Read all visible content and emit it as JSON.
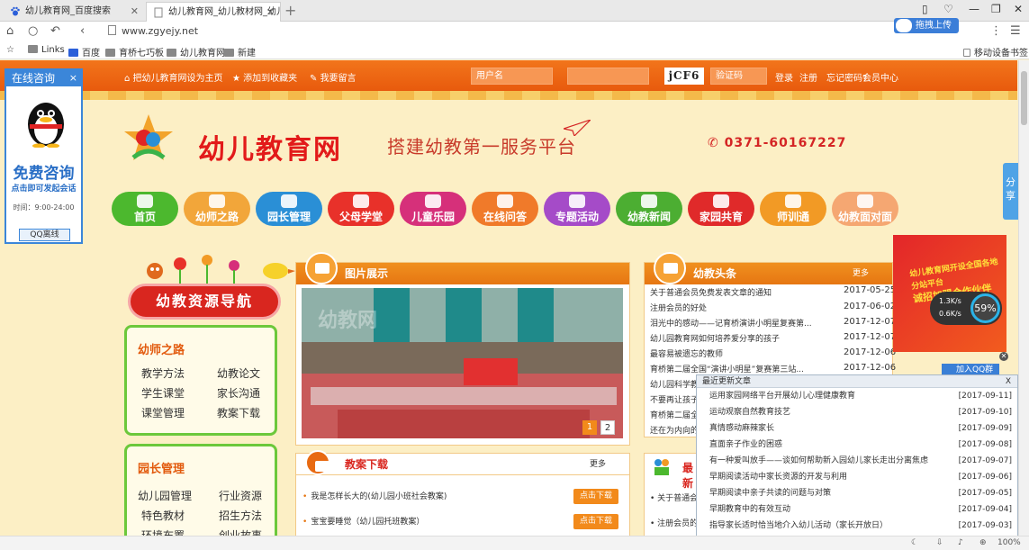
{
  "browser": {
    "tabs": [
      {
        "label": "幼儿教育网_百度搜索"
      },
      {
        "label": "幼儿教育网_幼儿教材网_幼儿"
      }
    ],
    "url": "www.zgyejy.net",
    "upload_label": "拖拽上传",
    "bookmarks": [
      "Links",
      "百度",
      "育桥七巧板",
      "幼儿教育网",
      "新建"
    ],
    "mobile_bookmarks": "移动设备书签",
    "zoom": "100%"
  },
  "topbar": {
    "set_home": "把幼儿教育网设为主页",
    "favorite": "添加到收藏夹",
    "message": "我要留言",
    "username_placeholder": "用户名",
    "captcha_text": "jCF6",
    "captcha_placeholder": "验证码",
    "login": "登录",
    "register": "注册",
    "forgot": "忘记密码?",
    "member": "会员中心"
  },
  "header": {
    "site_name": "幼儿教育网",
    "slogan": "搭建幼教第一服务平台",
    "phone": "0371-60167227"
  },
  "nav": [
    {
      "label": "首页",
      "color": "#4cb82e"
    },
    {
      "label": "幼师之路",
      "color": "#f2a63a"
    },
    {
      "label": "园长管理",
      "color": "#2a8fd6"
    },
    {
      "label": "父母学堂",
      "color": "#e8312a"
    },
    {
      "label": "儿童乐园",
      "color": "#d6307a"
    },
    {
      "label": "在线问答",
      "color": "#f07a2a"
    },
    {
      "label": "专题活动",
      "color": "#a54bc8"
    },
    {
      "label": "幼教新闻",
      "color": "#4cae32"
    },
    {
      "label": "家园共育",
      "color": "#e02a2a"
    },
    {
      "label": "师训通",
      "color": "#f29a25"
    },
    {
      "label": "幼教面对面",
      "color": "#f5a772"
    }
  ],
  "sidebar": {
    "title": "幼教资源导航",
    "cats": [
      {
        "title": "幼师之路",
        "items": [
          "教学方法",
          "幼教论文",
          "学生课堂",
          "家长沟通",
          "课堂管理",
          "教案下载"
        ]
      },
      {
        "title": "园长管理",
        "items": [
          "幼儿园管理",
          "行业资源",
          "特色教材",
          "招生方法",
          "环境布置",
          "创业故事"
        ]
      }
    ]
  },
  "photos": {
    "title": "图片展示",
    "watermark": "幼教网",
    "pages": [
      "1",
      "2"
    ]
  },
  "headlines": {
    "title": "幼教头条",
    "more": "更多",
    "items": [
      {
        "title": "关于普通会员免费发表文章的通知",
        "date": "2017-05-25"
      },
      {
        "title": "注册会员的好处",
        "date": "2017-06-02"
      },
      {
        "title": "泪光中的感动——记育桥演讲小明星复赛第...",
        "date": "2017-12-07"
      },
      {
        "title": "幼儿园教育网如何培养爱分享的孩子",
        "date": "2017-12-07"
      },
      {
        "title": "最容易被遗忘的教师",
        "date": "2017-12-06"
      },
      {
        "title": "育桥第二届全国“演讲小明星”复赛第三站...",
        "date": "2017-12-06"
      },
      {
        "title": "幼儿园科学教",
        "date": ""
      },
      {
        "title": "不要再让孩子",
        "date": ""
      },
      {
        "title": "育桥第二届全",
        "date": ""
      },
      {
        "title": "还在为内向的",
        "date": ""
      }
    ]
  },
  "downloads": {
    "title": "教案下载",
    "more": "更多",
    "items": [
      {
        "title": "我是怎样长大的(幼儿园小班社会教案)",
        "btn": "点击下载"
      },
      {
        "title": "宝宝要睡觉（幼儿园托班教案）",
        "btn": "点击下载"
      }
    ]
  },
  "latest": {
    "title": "最新",
    "items": [
      "关于普通会",
      "注册会员的"
    ]
  },
  "ad": {
    "line1": "幼儿教育网开设全国各地分站平台",
    "line2": "诚招加盟合作伙伴"
  },
  "speed": {
    "up": "1.3K/s",
    "down": "0.6K/s",
    "pct": "59%"
  },
  "qq_group": "加入QQ群",
  "consult": {
    "title": "在线咨询",
    "free": "免费咨询",
    "tap": "点击即可发起会话",
    "hours": "时间：9:00-24:00",
    "qq": "QQ离线"
  },
  "share": "分享",
  "popup": {
    "title": "最近更新文章",
    "close": "X",
    "items": [
      {
        "title": "运用家园网络平台开展幼儿心理健康教育",
        "date": "[2017-09-11]"
      },
      {
        "title": "运动观察自然教育技艺",
        "date": "[2017-09-10]"
      },
      {
        "title": "真情感动麻辣家长",
        "date": "[2017-09-09]"
      },
      {
        "title": "直面亲子作业的困惑",
        "date": "[2017-09-08]"
      },
      {
        "title": "有一种爱叫放手——谈如何帮助新入园幼儿家长走出分离焦虑",
        "date": "[2017-09-07]"
      },
      {
        "title": "早期阅读活动中家长资源的开发与利用",
        "date": "[2017-09-06]"
      },
      {
        "title": "早期阅读中亲子共读的问题与对策",
        "date": "[2017-09-05]"
      },
      {
        "title": "早期教育中的有效互动",
        "date": "[2017-09-04]"
      },
      {
        "title": "指导家长适时恰当地介入幼儿活动（家长开放日）",
        "date": "[2017-09-03]"
      }
    ]
  }
}
